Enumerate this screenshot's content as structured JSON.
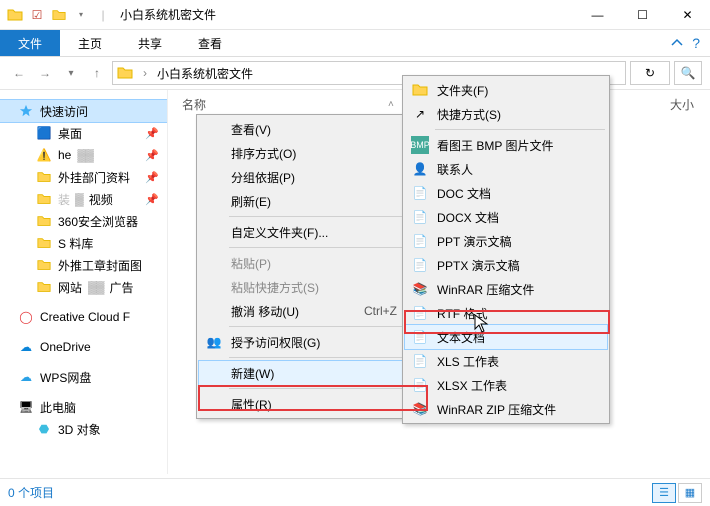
{
  "title": "小白系统机密文件",
  "tabs": {
    "file": "文件",
    "home": "主页",
    "share": "共享",
    "view": "查看"
  },
  "path": {
    "label": "小白系统机密文件"
  },
  "nav": {
    "quick": "快速访问",
    "desktop": "桌面",
    "item1": "he",
    "item2": "外挂部门资料",
    "item3": "装机视频",
    "item4": "360安全浏览器",
    "item5": "S         料库",
    "item6": "外推工章封面图",
    "item7": "网站",
    "item7b": "广告",
    "ccf": "Creative Cloud F",
    "onedrive": "OneDrive",
    "wps": "WPS网盘",
    "thispc": "此电脑",
    "obj3d": "3D 对象"
  },
  "list_header": {
    "name": "名称",
    "size": "大小"
  },
  "status": "0 个项目",
  "ctx1": {
    "view": "查看(V)",
    "sort": "排序方式(O)",
    "group": "分组依据(P)",
    "refresh": "刷新(E)",
    "customize": "自定义文件夹(F)...",
    "paste": "粘贴(P)",
    "paste_shortcut": "粘贴快捷方式(S)",
    "undo": "撤消 移动(U)",
    "undo_key": "Ctrl+Z",
    "grant": "授予访问权限(G)",
    "new": "新建(W)",
    "props": "属性(R)"
  },
  "ctx2": {
    "folder": "文件夹(F)",
    "shortcut": "快捷方式(S)",
    "bmp": "看图王 BMP 图片文件",
    "contact": "联系人",
    "doc": "DOC 文档",
    "docx": "DOCX 文档",
    "ppt": "PPT 演示文稿",
    "pptx": "PPTX 演示文稿",
    "rar": "WinRAR 压缩文件",
    "rtf": "RTF 格式",
    "txt": "文本文档",
    "xls": "XLS 工作表",
    "xlsx": "XLSX 工作表",
    "zip": "WinRAR ZIP 压缩文件"
  }
}
